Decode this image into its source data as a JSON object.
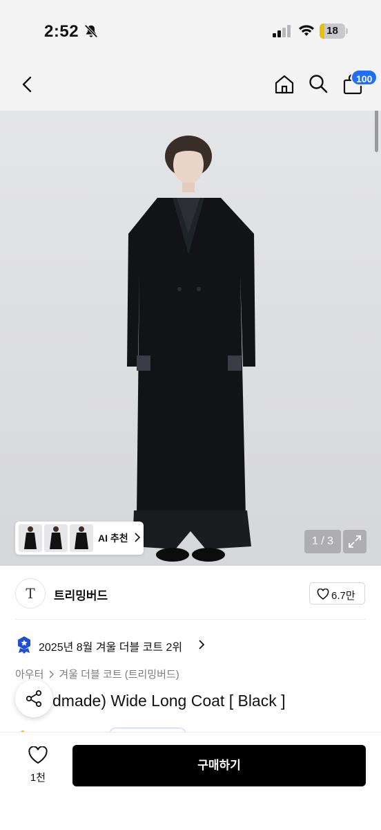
{
  "status_bar": {
    "time": "2:52",
    "battery_level": "18",
    "battery_fraction": 0.18,
    "icons": [
      "bell-slash-icon",
      "cellular-signal-icon",
      "wifi-icon",
      "battery-icon"
    ]
  },
  "nav": {
    "icons": [
      "chevron-left-icon",
      "home-icon",
      "search-icon",
      "shopping-bag-icon"
    ],
    "cart_badge": "100"
  },
  "gallery": {
    "thumbnails": [
      "thumbnail-1",
      "thumbnail-2",
      "thumbnail-3"
    ],
    "ai_recommend_label": "AI 추천",
    "page_counter": "1 / 3",
    "expand_icon": "expand-icon"
  },
  "brand": {
    "logo_text": "T",
    "name": "트리밍버드",
    "like_count": "6.7만"
  },
  "ranking": {
    "text": "2025년 8월 겨울 더블 코트 2위"
  },
  "breadcrumb": {
    "level1": "아우터",
    "level2": "겨울 더블 코트 (트리밍버드)"
  },
  "product": {
    "title": "(Handmade) Wide Long Coat [ Black ]",
    "title_visible": "dmade) Wide Long Coat [ Black ]"
  },
  "bottom_bar": {
    "wish_count": "1천",
    "buy_label": "구매하기"
  },
  "colors": {
    "accent_blue": "#1f6fff",
    "button_black": "#000000",
    "background_gray": "#f4f4f5"
  }
}
